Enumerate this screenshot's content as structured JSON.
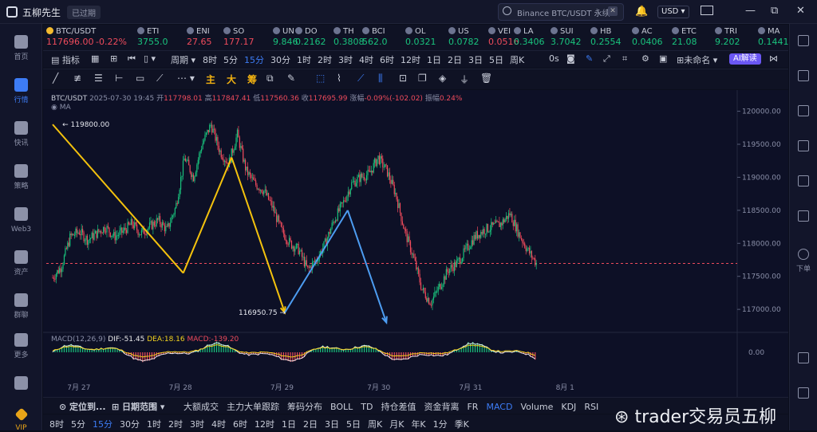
{
  "window": {
    "app_title": "五柳先生",
    "expired_badge": "已过期",
    "search_placeholder": "Binance BTC/USDT 永续",
    "currency": "USD",
    "controls": {
      "minimize": "—",
      "restore": "⧉",
      "close": "✕"
    }
  },
  "nav": [
    {
      "label": "首页",
      "active": false
    },
    {
      "label": "行情",
      "active": true
    },
    {
      "label": "快讯",
      "active": false
    },
    {
      "label": "策略",
      "active": false
    },
    {
      "label": "Web3",
      "active": false
    },
    {
      "label": "资产",
      "active": false
    },
    {
      "label": "群聊",
      "active": false
    },
    {
      "label": "更多",
      "active": false
    },
    {
      "label": "VIP",
      "active": false
    }
  ],
  "right_panel": {
    "label": "下单"
  },
  "tickers": [
    {
      "sym": "BTC/USDT",
      "price": "117696.00",
      "change": "-0.22%",
      "dir": "down"
    },
    {
      "sym": "ETI",
      "price": "3755.0",
      "dir": "up"
    },
    {
      "sym": "ENI",
      "price": "27.65",
      "dir": "down"
    },
    {
      "sym": "SO",
      "price": "177.17",
      "dir": "down"
    },
    {
      "sym": "UN",
      "price": "9.846",
      "dir": "up"
    },
    {
      "sym": "DO",
      "price": "0.2162",
      "dir": "up"
    },
    {
      "sym": "TH",
      "price": "0.3808",
      "dir": "up"
    },
    {
      "sym": "BCI",
      "price": "562.0",
      "dir": "up"
    },
    {
      "sym": "OL",
      "price": "0.0321",
      "dir": "up"
    },
    {
      "sym": "US",
      "price": "0.0782",
      "dir": "up"
    },
    {
      "sym": "VEI",
      "price": "0.0516",
      "dir": "down"
    },
    {
      "sym": "LA",
      "price": "0.3406",
      "dir": "up"
    },
    {
      "sym": "SUI",
      "price": "3.7042",
      "dir": "up"
    },
    {
      "sym": "HB",
      "price": "0.2554",
      "dir": "up"
    },
    {
      "sym": "AC",
      "price": "0.0406",
      "dir": "up"
    },
    {
      "sym": "ETC",
      "price": "21.08",
      "dir": "up"
    },
    {
      "sym": "TRI",
      "price": "9.202",
      "dir": "up"
    },
    {
      "sym": "MA",
      "price": "0.1441",
      "dir": "up"
    }
  ],
  "toolbar1": {
    "indicators": "指标",
    "period": "周期",
    "intervals": [
      "8时",
      "5分",
      "15分",
      "30分",
      "1时",
      "2时",
      "3时",
      "4时",
      "6时",
      "12时",
      "1日",
      "2日",
      "3日",
      "5日",
      "周K"
    ],
    "selected_interval": "15分",
    "countdown": "0s",
    "layout_name": "未命名",
    "ai_label": "AI解读"
  },
  "toolbar2": {
    "text_tools": [
      "主",
      "大",
      "筹"
    ]
  },
  "chart_legend": {
    "pair": "BTC/USDT",
    "datetime": "2025-07-30 19:45",
    "open_label": "开",
    "open": "117798.01",
    "high_label": "高",
    "high": "117847.41",
    "low_label": "低",
    "low": "117560.36",
    "close_label": "收",
    "close": "117695.99",
    "chg_label": "涨幅",
    "chg": "-0.09%(-102.02)",
    "amp_label": "振幅",
    "amp": "0.24%",
    "ma": "MA"
  },
  "macd_legend": {
    "name": "MACD(12,26,9)",
    "dif": "DIF:-51.45",
    "dea": "DEA:18.16",
    "macd": "MACD:-139.20"
  },
  "chart_data": {
    "type": "candlestick",
    "ylim": [
      116700,
      120200
    ],
    "yticks": [
      120000,
      119500,
      119000,
      118500,
      118000,
      117500,
      117000
    ],
    "ytick_labels": [
      "120000.00",
      "119500.00",
      "119000.00",
      "118500.00",
      "118000.00",
      "117500.00",
      "117000.00"
    ],
    "current_price": 117696,
    "xticks": [
      "7月 27",
      "7月 28",
      "7月 29",
      "7月 30",
      "7月 31",
      "8月 1"
    ],
    "annotations": [
      {
        "text": "119800.00",
        "value": 119800
      },
      {
        "text": "116950.75",
        "value": 116950.75
      }
    ],
    "close_path": [
      117480,
      117650,
      118100,
      118180,
      118050,
      118150,
      118250,
      118100,
      118180,
      118300,
      118150,
      118250,
      118350,
      118200,
      118550,
      119300,
      119000,
      119500,
      119800,
      119400,
      119200,
      119650,
      119100,
      118900,
      118800,
      118550,
      118200,
      118000,
      117900,
      117600,
      117750,
      118000,
      118350,
      118600,
      118900,
      119000,
      119050,
      119300,
      119100,
      118750,
      118200,
      117800,
      117300,
      117100,
      117350,
      117600,
      117700,
      117900,
      118100,
      118200,
      118250,
      118300,
      118450,
      118150,
      117900,
      117700
    ],
    "overlays": [
      {
        "color": "#f4c20d",
        "points": [
          [
            0.0,
            119800
          ],
          [
            0.27,
            117550
          ],
          [
            0.37,
            119300
          ],
          [
            0.48,
            116950
          ]
        ]
      },
      {
        "color": "#4d9df2",
        "points": [
          [
            0.48,
            116950
          ],
          [
            0.61,
            118500
          ],
          [
            0.69,
            116800
          ]
        ]
      }
    ],
    "macd_ylim": [
      -300,
      300
    ],
    "macd_tick": "0.00"
  },
  "bottom1": {
    "locate": "定位到...",
    "range": "日期范围",
    "items": [
      "大额成交",
      "主力大单跟踪",
      "筹码分布",
      "BOLL",
      "TD",
      "持仓差值",
      "资金背离",
      "FR",
      "MACD",
      "Volume",
      "KDJ",
      "RSI"
    ],
    "selected": "MACD"
  },
  "bottom2": {
    "intervals": [
      "8时",
      "5分",
      "15分",
      "30分",
      "1时",
      "2时",
      "3时",
      "4时",
      "6时",
      "12时",
      "1日",
      "2日",
      "3日",
      "5日",
      "周K",
      "月K",
      "年K",
      "1分",
      "季K"
    ],
    "selected": "15分"
  },
  "watermark": "trader交易员五柳"
}
